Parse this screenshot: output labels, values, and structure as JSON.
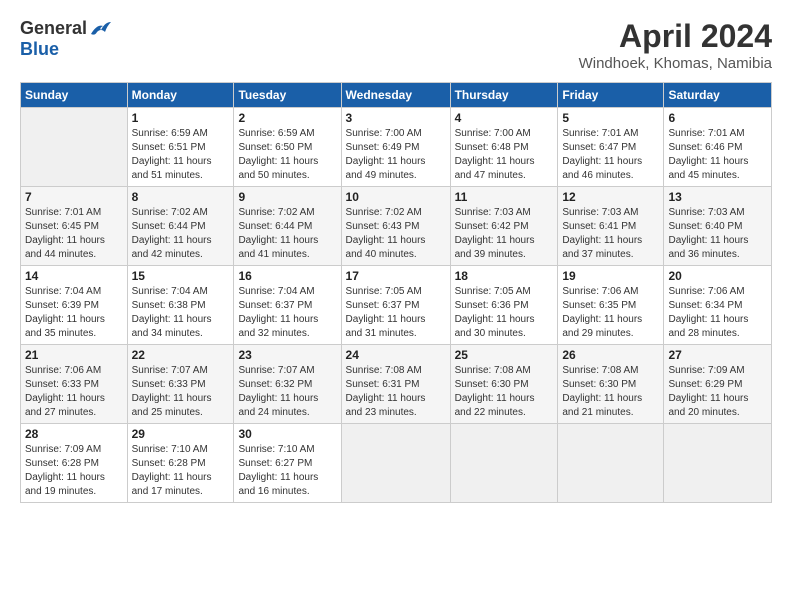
{
  "header": {
    "logo_general": "General",
    "logo_blue": "Blue",
    "title": "April 2024",
    "subtitle": "Windhoek, Khomas, Namibia"
  },
  "calendar": {
    "days_of_week": [
      "Sunday",
      "Monday",
      "Tuesday",
      "Wednesday",
      "Thursday",
      "Friday",
      "Saturday"
    ],
    "weeks": [
      [
        {
          "day": "",
          "info": ""
        },
        {
          "day": "1",
          "info": "Sunrise: 6:59 AM\nSunset: 6:51 PM\nDaylight: 11 hours\nand 51 minutes."
        },
        {
          "day": "2",
          "info": "Sunrise: 6:59 AM\nSunset: 6:50 PM\nDaylight: 11 hours\nand 50 minutes."
        },
        {
          "day": "3",
          "info": "Sunrise: 7:00 AM\nSunset: 6:49 PM\nDaylight: 11 hours\nand 49 minutes."
        },
        {
          "day": "4",
          "info": "Sunrise: 7:00 AM\nSunset: 6:48 PM\nDaylight: 11 hours\nand 47 minutes."
        },
        {
          "day": "5",
          "info": "Sunrise: 7:01 AM\nSunset: 6:47 PM\nDaylight: 11 hours\nand 46 minutes."
        },
        {
          "day": "6",
          "info": "Sunrise: 7:01 AM\nSunset: 6:46 PM\nDaylight: 11 hours\nand 45 minutes."
        }
      ],
      [
        {
          "day": "7",
          "info": "Sunrise: 7:01 AM\nSunset: 6:45 PM\nDaylight: 11 hours\nand 44 minutes."
        },
        {
          "day": "8",
          "info": "Sunrise: 7:02 AM\nSunset: 6:44 PM\nDaylight: 11 hours\nand 42 minutes."
        },
        {
          "day": "9",
          "info": "Sunrise: 7:02 AM\nSunset: 6:44 PM\nDaylight: 11 hours\nand 41 minutes."
        },
        {
          "day": "10",
          "info": "Sunrise: 7:02 AM\nSunset: 6:43 PM\nDaylight: 11 hours\nand 40 minutes."
        },
        {
          "day": "11",
          "info": "Sunrise: 7:03 AM\nSunset: 6:42 PM\nDaylight: 11 hours\nand 39 minutes."
        },
        {
          "day": "12",
          "info": "Sunrise: 7:03 AM\nSunset: 6:41 PM\nDaylight: 11 hours\nand 37 minutes."
        },
        {
          "day": "13",
          "info": "Sunrise: 7:03 AM\nSunset: 6:40 PM\nDaylight: 11 hours\nand 36 minutes."
        }
      ],
      [
        {
          "day": "14",
          "info": "Sunrise: 7:04 AM\nSunset: 6:39 PM\nDaylight: 11 hours\nand 35 minutes."
        },
        {
          "day": "15",
          "info": "Sunrise: 7:04 AM\nSunset: 6:38 PM\nDaylight: 11 hours\nand 34 minutes."
        },
        {
          "day": "16",
          "info": "Sunrise: 7:04 AM\nSunset: 6:37 PM\nDaylight: 11 hours\nand 32 minutes."
        },
        {
          "day": "17",
          "info": "Sunrise: 7:05 AM\nSunset: 6:37 PM\nDaylight: 11 hours\nand 31 minutes."
        },
        {
          "day": "18",
          "info": "Sunrise: 7:05 AM\nSunset: 6:36 PM\nDaylight: 11 hours\nand 30 minutes."
        },
        {
          "day": "19",
          "info": "Sunrise: 7:06 AM\nSunset: 6:35 PM\nDaylight: 11 hours\nand 29 minutes."
        },
        {
          "day": "20",
          "info": "Sunrise: 7:06 AM\nSunset: 6:34 PM\nDaylight: 11 hours\nand 28 minutes."
        }
      ],
      [
        {
          "day": "21",
          "info": "Sunrise: 7:06 AM\nSunset: 6:33 PM\nDaylight: 11 hours\nand 27 minutes."
        },
        {
          "day": "22",
          "info": "Sunrise: 7:07 AM\nSunset: 6:33 PM\nDaylight: 11 hours\nand 25 minutes."
        },
        {
          "day": "23",
          "info": "Sunrise: 7:07 AM\nSunset: 6:32 PM\nDaylight: 11 hours\nand 24 minutes."
        },
        {
          "day": "24",
          "info": "Sunrise: 7:08 AM\nSunset: 6:31 PM\nDaylight: 11 hours\nand 23 minutes."
        },
        {
          "day": "25",
          "info": "Sunrise: 7:08 AM\nSunset: 6:30 PM\nDaylight: 11 hours\nand 22 minutes."
        },
        {
          "day": "26",
          "info": "Sunrise: 7:08 AM\nSunset: 6:30 PM\nDaylight: 11 hours\nand 21 minutes."
        },
        {
          "day": "27",
          "info": "Sunrise: 7:09 AM\nSunset: 6:29 PM\nDaylight: 11 hours\nand 20 minutes."
        }
      ],
      [
        {
          "day": "28",
          "info": "Sunrise: 7:09 AM\nSunset: 6:28 PM\nDaylight: 11 hours\nand 19 minutes."
        },
        {
          "day": "29",
          "info": "Sunrise: 7:10 AM\nSunset: 6:28 PM\nDaylight: 11 hours\nand 17 minutes."
        },
        {
          "day": "30",
          "info": "Sunrise: 7:10 AM\nSunset: 6:27 PM\nDaylight: 11 hours\nand 16 minutes."
        },
        {
          "day": "",
          "info": ""
        },
        {
          "day": "",
          "info": ""
        },
        {
          "day": "",
          "info": ""
        },
        {
          "day": "",
          "info": ""
        }
      ]
    ]
  }
}
